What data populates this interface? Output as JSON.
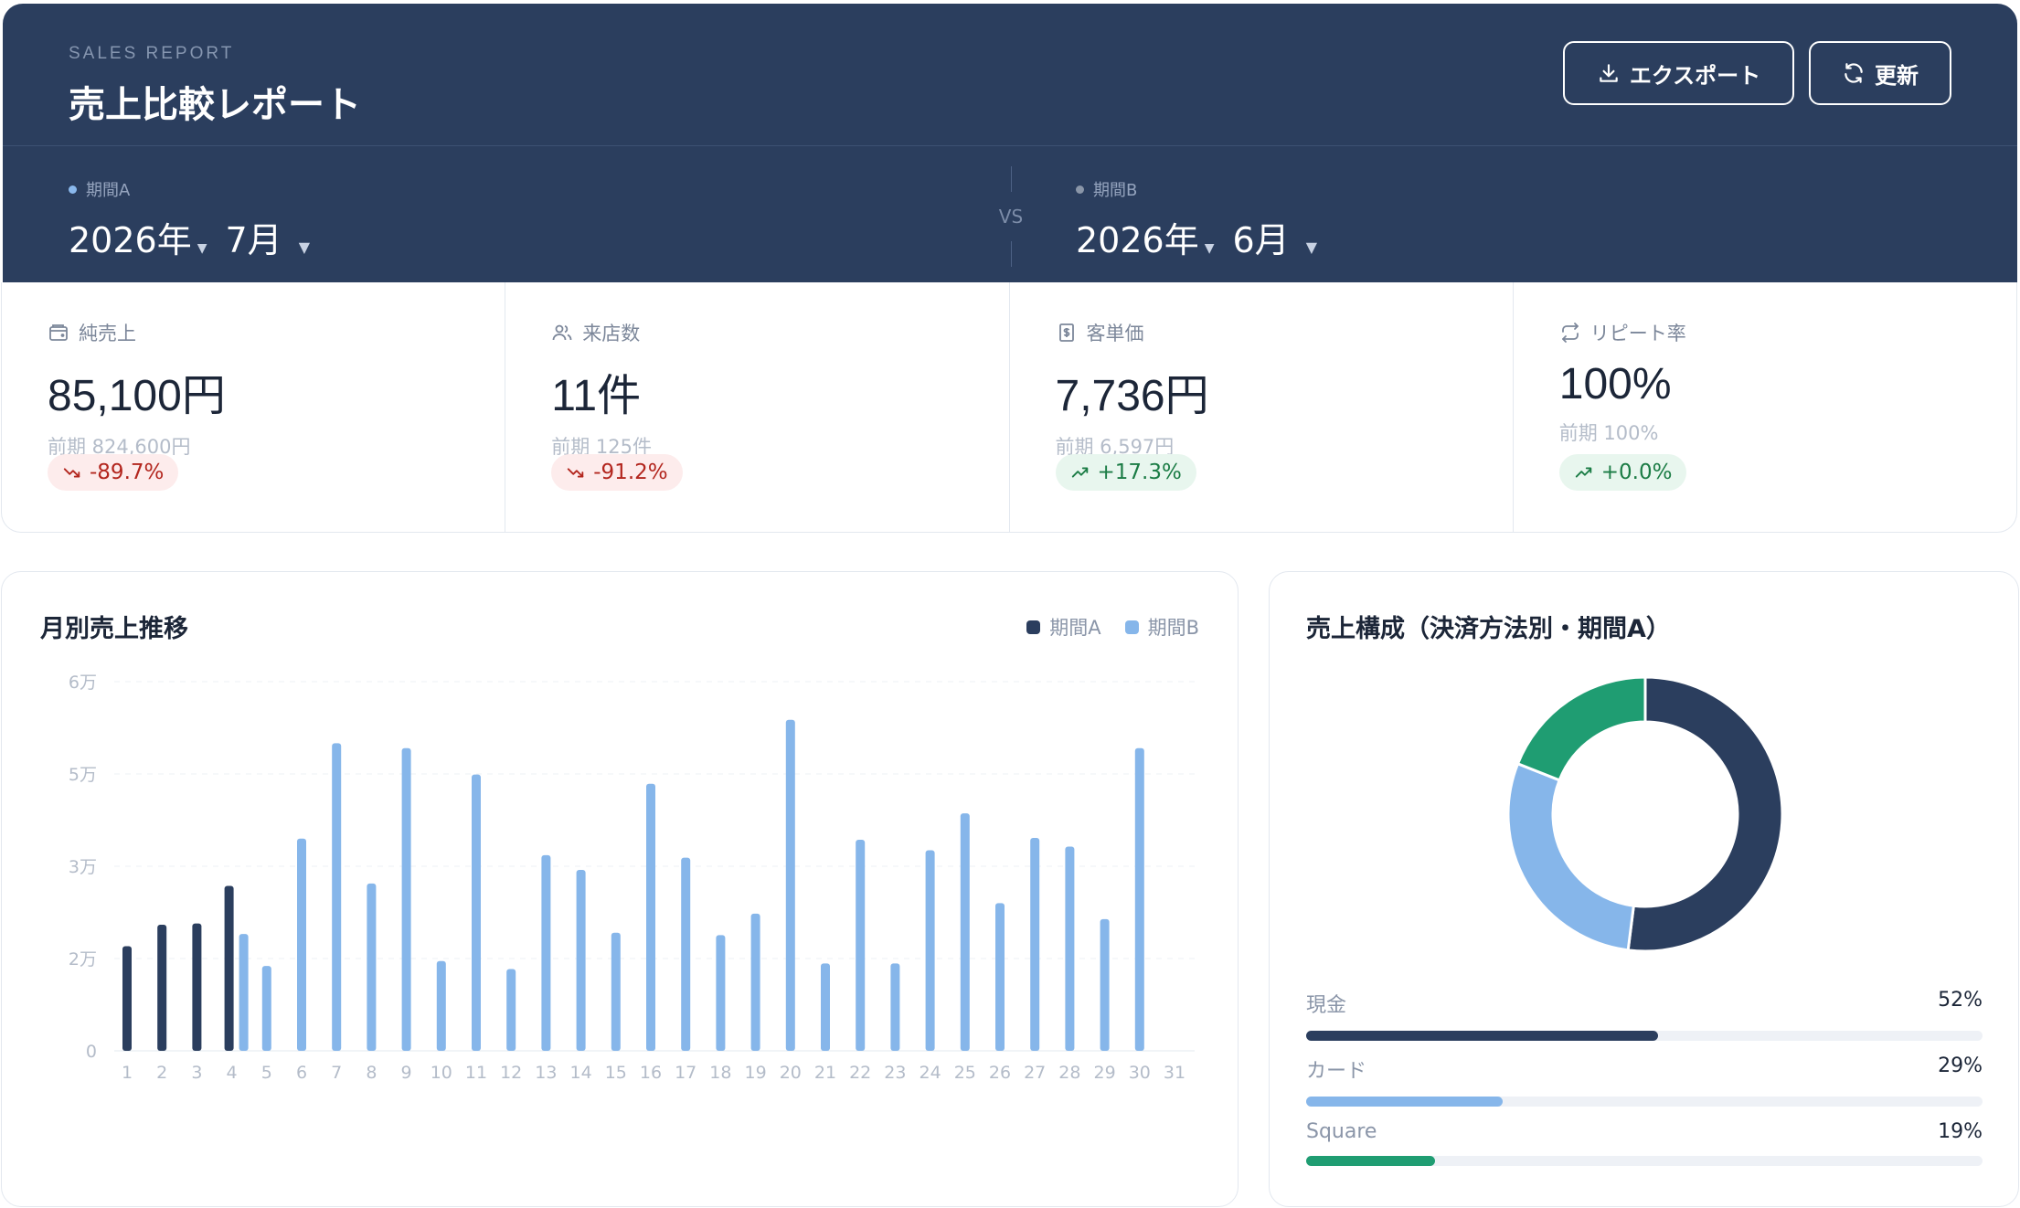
{
  "header": {
    "eyebrow": "SALES REPORT",
    "title": "売上比較レポート",
    "export_label": "エクスポート",
    "refresh_label": "更新"
  },
  "periods": {
    "a": {
      "label": "期間A",
      "year": "2026年",
      "month": "7月",
      "color": "#8ab8ec"
    },
    "vs": "VS",
    "b": {
      "label": "期間B",
      "year": "2026年",
      "month": "6月",
      "color": "#8a96a8"
    }
  },
  "kpis": [
    {
      "label": "純売上",
      "icon": "wallet-icon",
      "value": "85,100円",
      "prev": "前期 824,600円",
      "change": "-89.7%",
      "trend": "down"
    },
    {
      "label": "来店数",
      "icon": "users-icon",
      "value": "11件",
      "prev": "前期 125件",
      "change": "-91.2%",
      "trend": "down"
    },
    {
      "label": "客単価",
      "icon": "receipt-icon",
      "value": "7,736円",
      "prev": "前期 6,597円",
      "change": "+17.3%",
      "trend": "up"
    },
    {
      "label": "リピート率",
      "icon": "repeat-icon",
      "value": "100%",
      "prev": "前期 100%",
      "change": "+0.0%",
      "trend": "up"
    }
  ],
  "bar_card": {
    "title": "月別売上推移",
    "legend": [
      {
        "name": "期間A",
        "color": "#2b3e5e"
      },
      {
        "name": "期間B",
        "color": "#86b6ea"
      }
    ]
  },
  "chart_data": [
    {
      "type": "bar",
      "title": "月別売上推移",
      "categories": [
        "1",
        "2",
        "3",
        "4",
        "5",
        "6",
        "7",
        "8",
        "9",
        "10",
        "11",
        "12",
        "13",
        "14",
        "15",
        "16",
        "17",
        "18",
        "19",
        "20",
        "21",
        "22",
        "23",
        "24",
        "25",
        "26",
        "27",
        "28",
        "29",
        "30",
        "31"
      ],
      "y_ticks": [
        "0",
        "2万",
        "3万",
        "5万",
        "6万"
      ],
      "y_tick_values": [
        0,
        15000,
        30000,
        45000,
        60000
      ],
      "ylim": [
        0,
        60000
      ],
      "grid": true,
      "legend_position": "top-right",
      "series": [
        {
          "name": "期間A",
          "color": "#2b3e5e",
          "values": [
            17000,
            20500,
            20700,
            26800,
            null,
            null,
            null,
            null,
            null,
            null,
            null,
            null,
            null,
            null,
            null,
            null,
            null,
            null,
            null,
            null,
            null,
            null,
            null,
            null,
            null,
            null,
            null,
            null,
            null,
            null,
            null
          ]
        },
        {
          "name": "期間B",
          "color": "#86b6ea",
          "values": [
            null,
            null,
            null,
            19000,
            13800,
            34500,
            50000,
            27200,
            49200,
            14600,
            44900,
            13300,
            31800,
            29400,
            19200,
            43400,
            31400,
            18800,
            22300,
            53800,
            14200,
            34300,
            14200,
            32600,
            38600,
            24000,
            34600,
            33200,
            21400,
            49200,
            null
          ]
        }
      ]
    },
    {
      "type": "pie",
      "title": "売上構成（決済方法別・期間A）",
      "categories": [
        "現金",
        "カード",
        "Square"
      ],
      "values": [
        52,
        29,
        19
      ],
      "unit": "%",
      "colors": [
        "#2b3e5e",
        "#86b6ea",
        "#1f9d72"
      ]
    }
  ],
  "donut_card": {
    "title": "売上構成（決済方法別・期間A）",
    "items": [
      {
        "name": "現金",
        "pct": "52%",
        "value": 52,
        "color": "#2b3e5e"
      },
      {
        "name": "カード",
        "pct": "29%",
        "value": 29,
        "color": "#86b6ea"
      },
      {
        "name": "Square",
        "pct": "19%",
        "value": 19,
        "color": "#1f9d72"
      }
    ]
  }
}
